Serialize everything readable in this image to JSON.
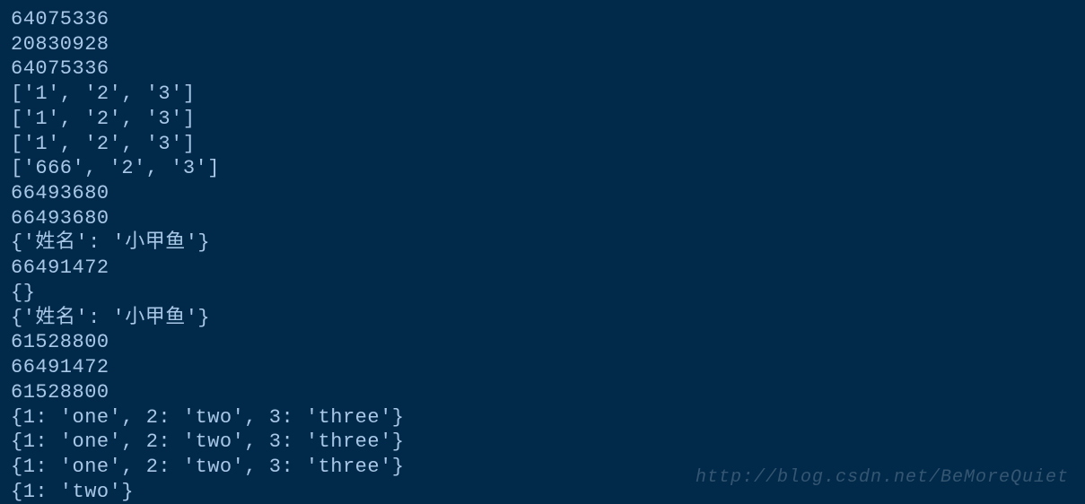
{
  "console": {
    "lines": [
      "64075336",
      "20830928",
      "64075336",
      "['1', '2', '3']",
      "['1', '2', '3']",
      "['1', '2', '3']",
      "['666', '2', '3']",
      "66493680",
      "66493680",
      "{'姓名': '小甲鱼'}",
      "66491472",
      "{}",
      "{'姓名': '小甲鱼'}",
      "61528800",
      "66491472",
      "61528800",
      "{1: 'one', 2: 'two', 3: 'three'}",
      "{1: 'one', 2: 'two', 3: 'three'}",
      "{1: 'one', 2: 'two', 3: 'three'}",
      "{1: 'two'}"
    ]
  },
  "watermark": {
    "text": "http://blog.csdn.net/BeMoreQuiet"
  }
}
